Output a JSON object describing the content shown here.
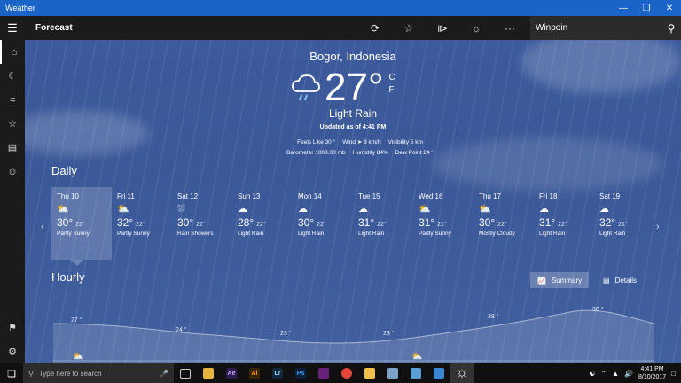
{
  "window": {
    "title": "Weather"
  },
  "appbar": {
    "title": "Forecast",
    "search_value": "Winpoin"
  },
  "current": {
    "location": "Bogor, Indonesia",
    "temperature": "27°",
    "unit_c": "C",
    "unit_f": "F",
    "condition": "Light Rain",
    "updated": "Updated as of 4:41 PM",
    "feels_like_label": "Feels Like",
    "feels_like": "30 °",
    "wind_label": "Wind",
    "wind": "8 km/h",
    "visibility_label": "Visibility",
    "visibility": "5 km",
    "barometer_label": "Barometer",
    "barometer": "1008.00 mb",
    "humidity_label": "Humidity",
    "humidity": "84%",
    "dewpoint_label": "Dew Point",
    "dewpoint": "24 °"
  },
  "daily": {
    "title": "Daily",
    "days": [
      {
        "name": "Thu 10",
        "high": "30°",
        "low": "22°",
        "cond": "Partly Sunny",
        "icon": "partly-sunny-icon"
      },
      {
        "name": "Fri 11",
        "high": "32°",
        "low": "22°",
        "cond": "Partly Sunny",
        "icon": "partly-sunny-icon"
      },
      {
        "name": "Sat 12",
        "high": "30°",
        "low": "22°",
        "cond": "Rain Showers",
        "icon": "rain-showers-icon"
      },
      {
        "name": "Sun 13",
        "high": "28°",
        "low": "22°",
        "cond": "Light Rain",
        "icon": "light-rain-icon"
      },
      {
        "name": "Mon 14",
        "high": "30°",
        "low": "22°",
        "cond": "Light Rain",
        "icon": "light-rain-icon"
      },
      {
        "name": "Tue 15",
        "high": "31°",
        "low": "22°",
        "cond": "Light Rain",
        "icon": "light-rain-icon"
      },
      {
        "name": "Wed 16",
        "high": "31°",
        "low": "21°",
        "cond": "Partly Sunny",
        "icon": "partly-sunny-icon"
      },
      {
        "name": "Thu 17",
        "high": "30°",
        "low": "22°",
        "cond": "Mostly Cloudy",
        "icon": "mostly-cloudy-icon"
      },
      {
        "name": "Fri 18",
        "high": "31°",
        "low": "22°",
        "cond": "Light Rain",
        "icon": "light-rain-icon"
      },
      {
        "name": "Sat 19",
        "high": "32°",
        "low": "21°",
        "cond": "Light Rain",
        "icon": "light-rain-icon"
      }
    ]
  },
  "hourly": {
    "title": "Hourly",
    "summary_label": "Summary",
    "details_label": "Details",
    "temps": [
      "27 °",
      "24 °",
      "23 °",
      "23 °",
      "28 °",
      "30 °"
    ]
  },
  "taskbar": {
    "search_placeholder": "Type here to search",
    "time": "4:41 PM",
    "date": "8/10/2017"
  },
  "colors": {
    "titlebar": "#1a64c8",
    "appbar": "#1b1b1b",
    "sky": "#3c5a9c"
  }
}
